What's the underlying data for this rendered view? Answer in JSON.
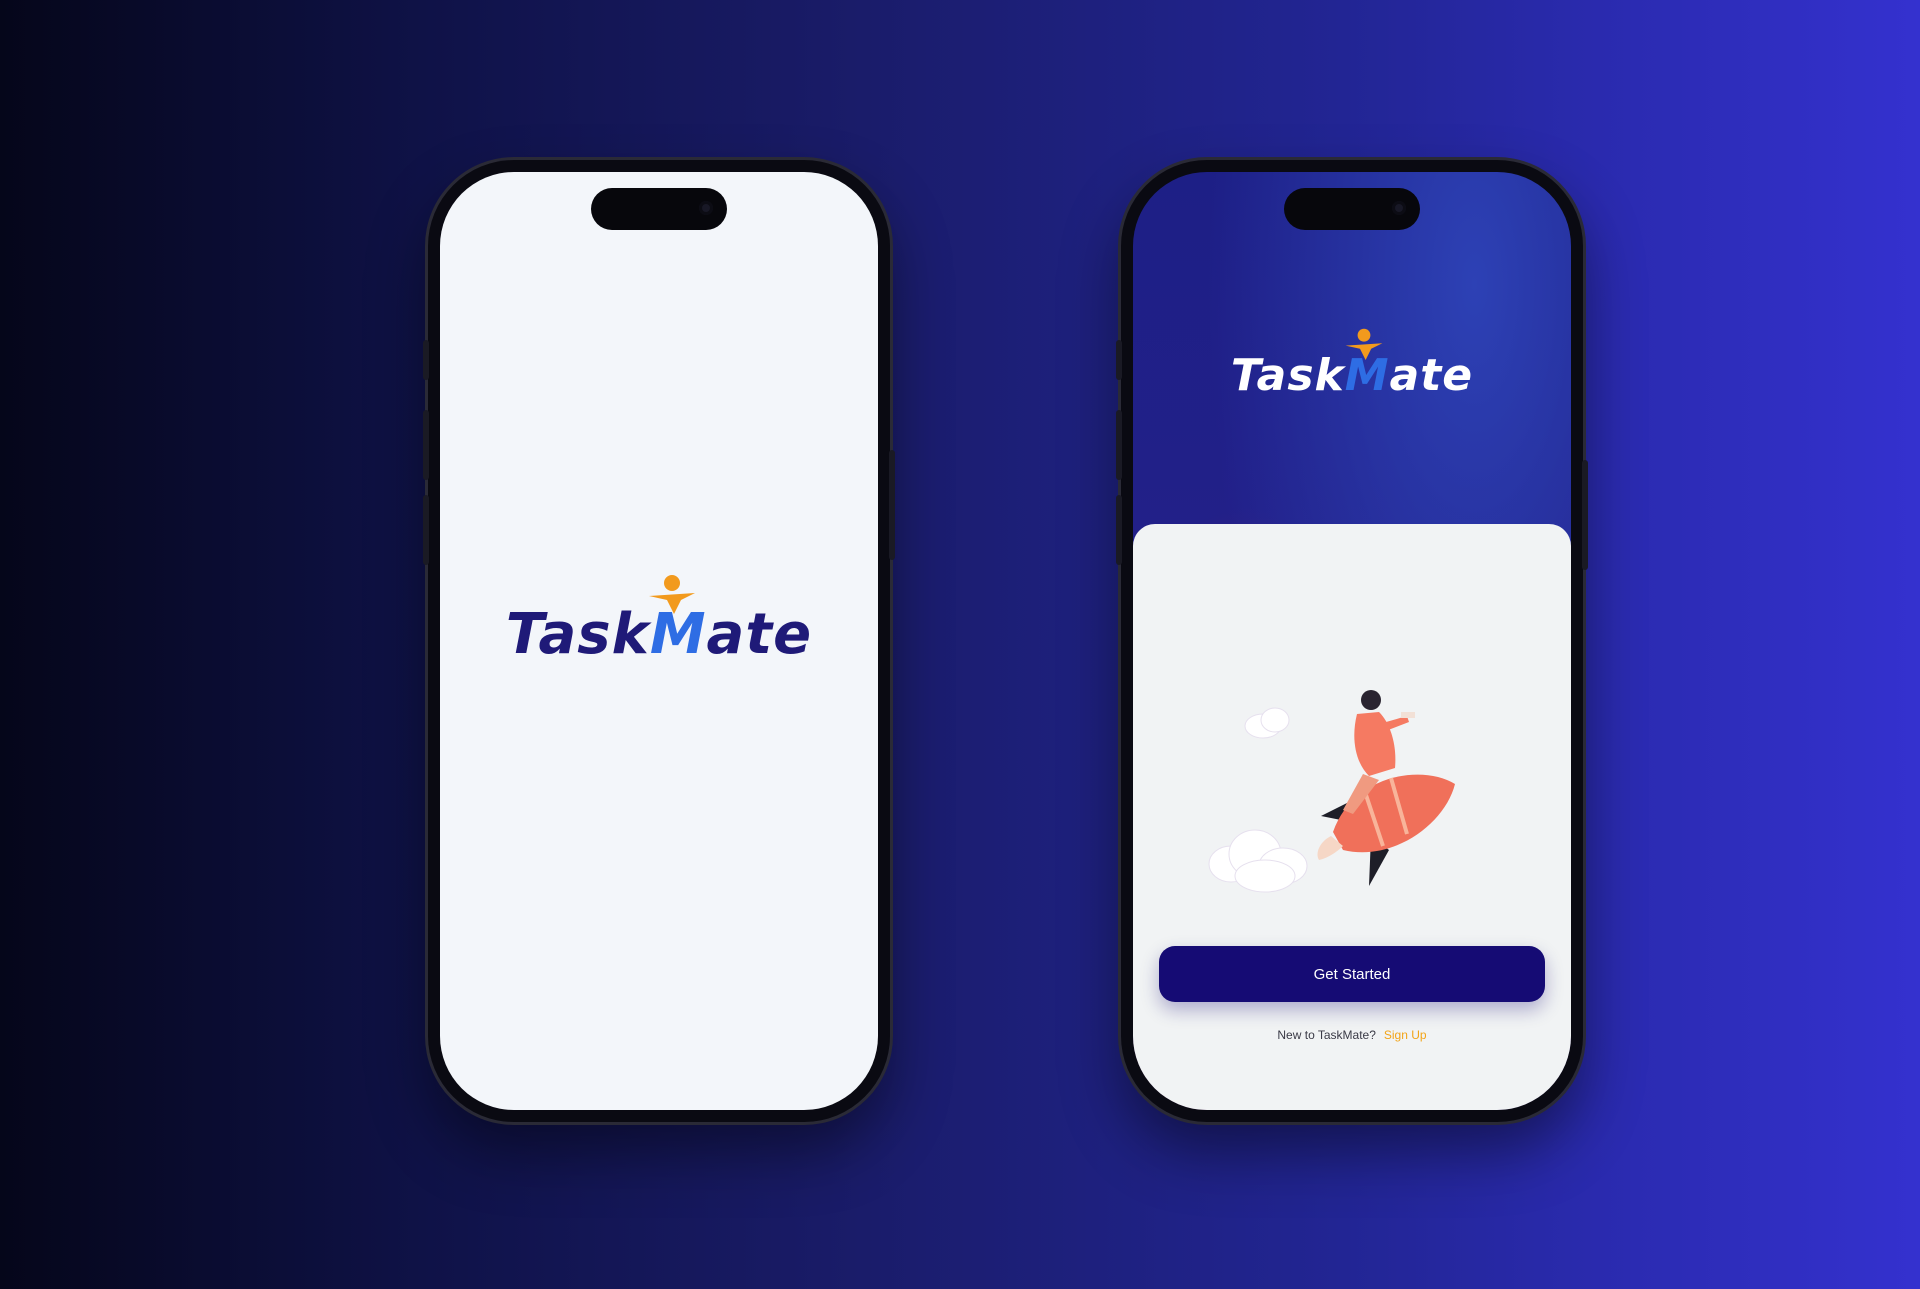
{
  "brand": {
    "logo_prefix": "Task",
    "logo_m": "M",
    "logo_suffix": "ate",
    "accent_color": "#f29a1d",
    "m_color": "#2e6de4",
    "primary_color": "#150b74",
    "link_color": "#f2a417"
  },
  "splash_screen": {
    "background": "#f3f6fa"
  },
  "welcome_screen": {
    "cta_label": "Get Started",
    "signup_prompt": "New to TaskMate?",
    "signup_link": "Sign Up",
    "illustration_icon": "rocket-rider-illustration"
  }
}
